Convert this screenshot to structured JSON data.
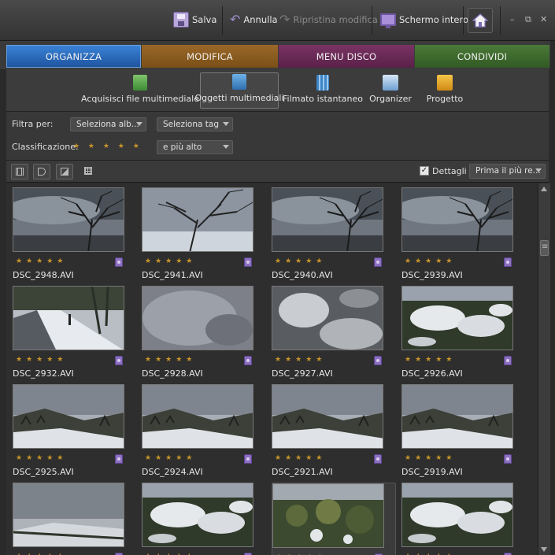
{
  "toolbar": {
    "save_label": "Salva",
    "undo_label": "Annulla",
    "redo_label": "Ripristina modifica",
    "fullscreen_label": "Schermo intero",
    "minimize": "–",
    "restore": "⧉",
    "close": "✕"
  },
  "tabs": [
    {
      "label": "ORGANIZZA",
      "color": "#2d6bb8"
    },
    {
      "label": "MODIFICA",
      "color": "#8a5a1e"
    },
    {
      "label": "MENU DISCO",
      "color": "#6a2a55"
    },
    {
      "label": "CONDIVIDI",
      "color": "#3d6b2e"
    }
  ],
  "subtoolbar": [
    {
      "label": "Acquisisci file multimediale",
      "active": false
    },
    {
      "label": "Oggetti multimediali",
      "active": true
    },
    {
      "label": "Filmato istantaneo",
      "active": false
    },
    {
      "label": "Organizer",
      "active": false
    },
    {
      "label": "Progetto",
      "active": false
    }
  ],
  "filters": {
    "filter_label": "Filtra per:",
    "album_select": "Seleziona alb...",
    "tag_select": "Seleziona tag",
    "rating_label": "Classificazione:",
    "rating_stars": "★ ★ ★ ★ ★",
    "rating_select": "e più alto"
  },
  "viewbar": {
    "details_label": "Dettagli",
    "details_checked": true,
    "sort_select": "Prima il più re..."
  },
  "media": [
    {
      "name": "DSC_2948.AVI",
      "scene": "tree-sky"
    },
    {
      "name": "DSC_2941.AVI",
      "scene": "tree-snow"
    },
    {
      "name": "DSC_2940.AVI",
      "scene": "tree-sky"
    },
    {
      "name": "DSC_2939.AVI",
      "scene": "tree-sky"
    },
    {
      "name": "DSC_2932.AVI",
      "scene": "road"
    },
    {
      "name": "DSC_2928.AVI",
      "scene": "blur"
    },
    {
      "name": "DSC_2927.AVI",
      "scene": "blur-snow"
    },
    {
      "name": "DSC_2926.AVI",
      "scene": "bush-snow"
    },
    {
      "name": "DSC_2925.AVI",
      "scene": "hill-snow"
    },
    {
      "name": "DSC_2924.AVI",
      "scene": "hill-snow"
    },
    {
      "name": "DSC_2921.AVI",
      "scene": "hill-snow"
    },
    {
      "name": "DSC_2919.AVI",
      "scene": "hill-snow"
    },
    {
      "name": "",
      "scene": "field"
    },
    {
      "name": "",
      "scene": "bush-snow"
    },
    {
      "name": "",
      "scene": "bush-green"
    },
    {
      "name": "",
      "scene": "bush-snow"
    }
  ],
  "stars_text": "★★★★★"
}
